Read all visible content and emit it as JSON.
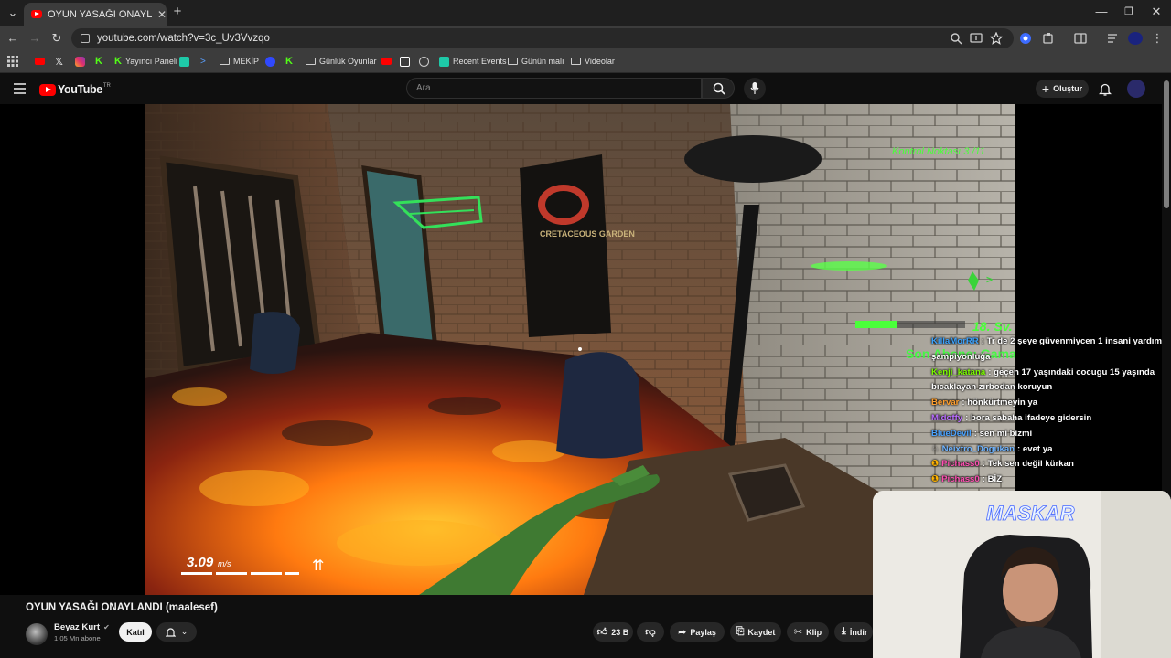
{
  "browser": {
    "tab_title": "OYUN YASAĞI ONAYLANDI (maalesef)",
    "tab_close": "✕",
    "new_tab": "+",
    "url": "youtube.com/watch?v=3c_Uv3Vvzqo",
    "window_controls": {
      "minimize": "—",
      "restore": "❐",
      "close": "✕"
    },
    "nav": {
      "back": "←",
      "forward": "→",
      "reload": "↻"
    }
  },
  "bookmarks": [
    {
      "label": "",
      "icon": "youtube-icon",
      "color": "#ff0000"
    },
    {
      "label": "",
      "icon": "x-icon",
      "color": "#ffffff"
    },
    {
      "label": "",
      "icon": "instagram-icon",
      "color": "#e1306c"
    },
    {
      "label": "",
      "icon": "kick-icon",
      "color": "#53fc18"
    },
    {
      "label": "Yayıncı Paneli",
      "icon": "kick-icon",
      "color": "#53fc18"
    },
    {
      "label": "",
      "icon": "generic-icon",
      "color": "#1ec9a8"
    },
    {
      "label": "",
      "icon": "arrow-icon",
      "color": "#5aa0ff"
    },
    {
      "label": "MEKİP",
      "icon": "folder-icon",
      "color": ""
    },
    {
      "label": "",
      "icon": "blue-icon",
      "color": "#3049ff"
    },
    {
      "label": "",
      "icon": "kick-icon",
      "color": "#53fc18"
    },
    {
      "label": "Günlük Oyunlar",
      "icon": "folder-icon",
      "color": ""
    },
    {
      "label": "",
      "icon": "youtube-icon",
      "color": "#ff0000"
    },
    {
      "label": "",
      "icon": "image-icon",
      "color": "#ffffff"
    },
    {
      "label": "",
      "icon": "globe-icon",
      "color": "#cccccc"
    },
    {
      "label": "Recent Events",
      "icon": "generic-icon",
      "color": "#1ec9a8"
    },
    {
      "label": "Günün malı",
      "icon": "folder-icon",
      "color": ""
    },
    {
      "label": "Videolar",
      "icon": "folder-icon",
      "color": ""
    }
  ],
  "youtube": {
    "logo_text": "YouTube",
    "logo_region": "TR",
    "search_placeholder": "Ara",
    "create_label": "Oluştur"
  },
  "game": {
    "checkpoint": "Kontrol Noktası 3 /11",
    "speed_value": "3.09",
    "speed_unit": "m/s",
    "level": "18. Sv.",
    "overlay_text": "Son Abone: GamaSLR",
    "poster_text": "CRETACEOUS GARDEN"
  },
  "chat": [
    {
      "user": "KillaMorRR",
      "color": "#3ba3ff",
      "text": "Tr de 2 şeye güvenmiycen 1 insani yardım 2 şampiyonluğa"
    },
    {
      "user": "Kenji_katana",
      "color": "#7cfc00",
      "text": "geçen 17 yaşındaki cocugu 15 yaşında bıcaklayan zırbodan koruyun"
    },
    {
      "user": "Bervar",
      "color": "#ff9f2e",
      "text": "hönkürtmeyin ya"
    },
    {
      "user": "Midoffy",
      "color": "#b96cff",
      "text": "bora sabaha ifadeye gidersin"
    },
    {
      "user": "BlueDevil",
      "color": "#4aa3ff",
      "text": "sen mi bizmi"
    },
    {
      "user": "Neixtro_Dogukan",
      "color": "#6fb4ff",
      "text": "evet ya"
    },
    {
      "user": "Pichass0",
      "color": "#ff4fb2",
      "text": "Tek sen değil kürkan"
    },
    {
      "user": "Pichass0",
      "color": "#ff4fb2",
      "text": "BİZ"
    }
  ],
  "webcam": {
    "label": "MASKAR"
  },
  "video": {
    "title": "OYUN YASAĞI ONAYLANDI (maalesef)",
    "channel": "Beyaz Kurt",
    "subscribers": "1,05 Mn abone",
    "join_label": "Katıl",
    "likes": "23 B",
    "share_label": "Paylaş",
    "save_label": "Kaydet",
    "clip_label": "Klip",
    "download_label": "İndir"
  }
}
